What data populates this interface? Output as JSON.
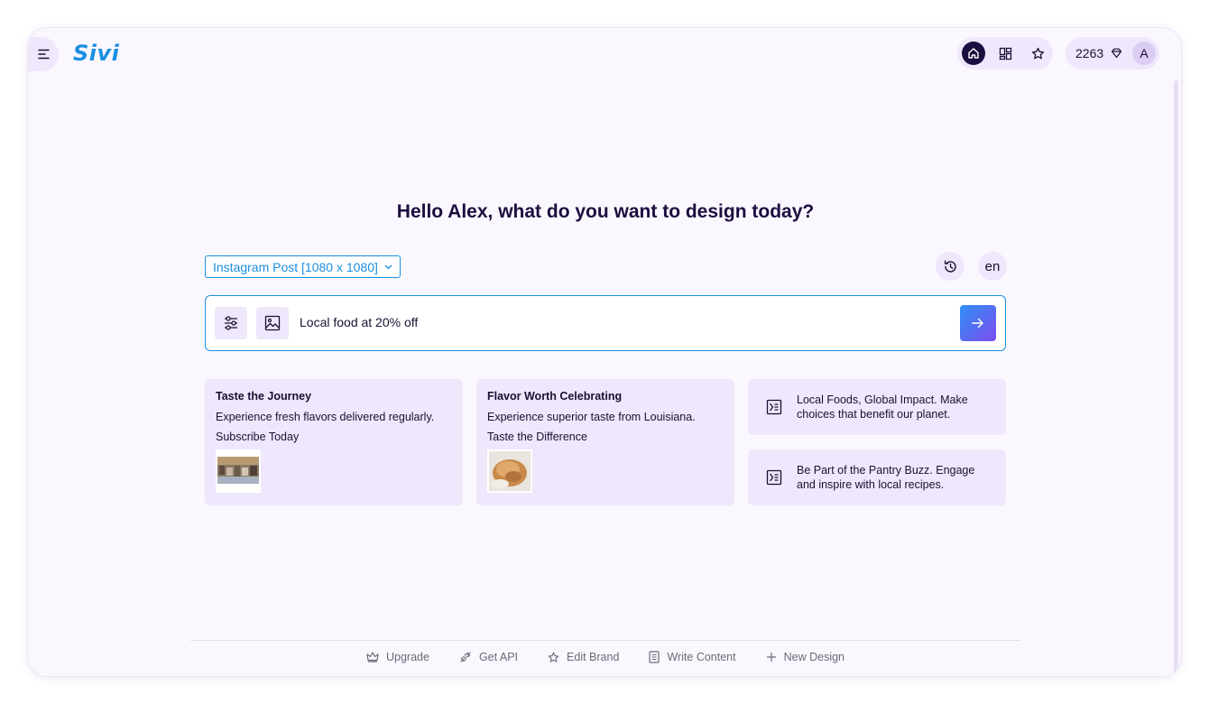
{
  "header": {
    "logo": "Sivi",
    "credits": "2263",
    "avatar_initial": "A",
    "nav_icons": [
      "home-icon",
      "grid-icon",
      "star-icon"
    ]
  },
  "main": {
    "headline": "Hello Alex, what do you want to design today?",
    "format_select": "Instagram Post [1080 x 1080]",
    "language": "en",
    "prompt_value": "Local food at 20% off"
  },
  "suggestions": [
    {
      "title": "Taste the Journey",
      "line1": "Experience fresh flavors delivered regularly.",
      "line2": "Subscribe Today"
    },
    {
      "title": "Flavor Worth Celebrating",
      "line1": "Experience superior taste from Louisiana.",
      "line2": "Taste the Difference"
    }
  ],
  "text_suggestions": [
    {
      "text": "Local Foods, Global Impact. Make choices that benefit our planet."
    },
    {
      "text": "Be Part of the Pantry Buzz. Engage and inspire with local recipes."
    }
  ],
  "footer": {
    "links": [
      "Upgrade",
      "Get API",
      "Edit Brand",
      "Write Content",
      "New Design"
    ]
  },
  "colors": {
    "accent": "#1b8fe0",
    "dark": "#1c0d3f",
    "panel": "#efe7fb",
    "background": "#faf7fe"
  }
}
